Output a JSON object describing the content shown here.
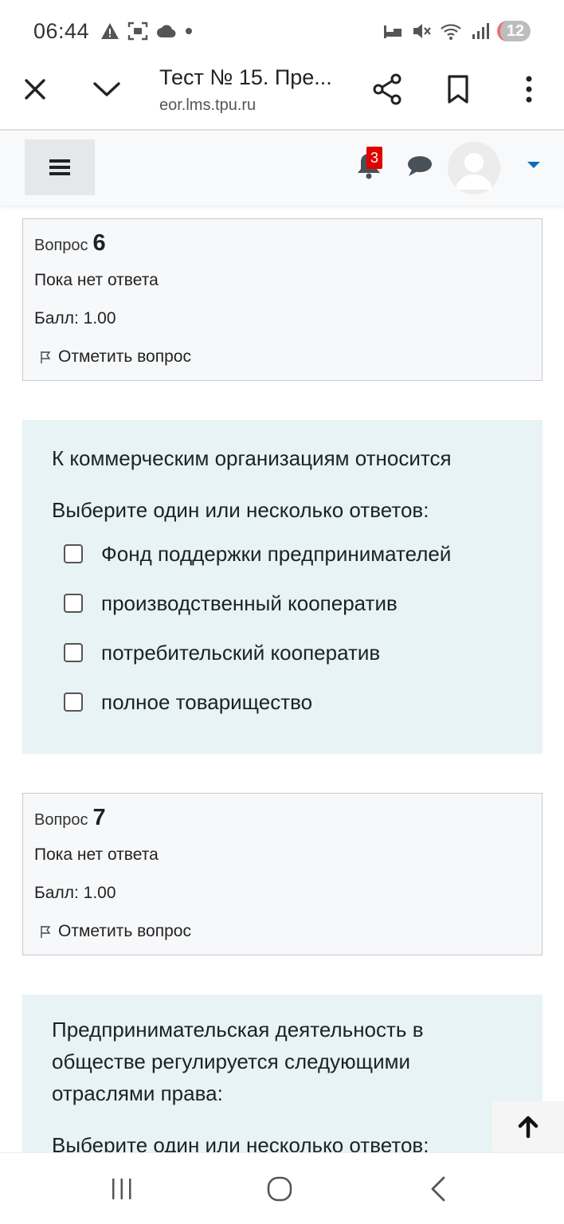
{
  "status_bar": {
    "time": "06:44",
    "battery": "12",
    "icons": [
      "warning-icon",
      "screenshot-icon",
      "cloud-icon",
      "dot-icon",
      "sleep-icon",
      "mute-icon",
      "wifi-icon",
      "signal-icon"
    ]
  },
  "browser": {
    "title": "Тест № 15. Пре...",
    "url": "eor.lms.tpu.ru"
  },
  "navbar": {
    "notification_count": "3"
  },
  "questions": [
    {
      "label": "Вопрос",
      "number": "6",
      "state": "Пока нет ответа",
      "grade": "Балл: 1.00",
      "flag": "Отметить вопрос",
      "text": "К коммерческим организациям относится",
      "prompt": "Выберите один или несколько ответов:",
      "answers": [
        "Фонд поддержки предпринимателей",
        "производственный кооператив",
        "потребительский кооператив",
        "полное товарищество"
      ]
    },
    {
      "label": "Вопрос",
      "number": "7",
      "state": "Пока нет ответа",
      "grade": "Балл: 1.00",
      "flag": "Отметить вопрос",
      "text": "Предпринимательская деятельность в обществе регулируется следующими отраслями права:",
      "prompt": "Выберите один или несколько ответов:"
    }
  ]
}
